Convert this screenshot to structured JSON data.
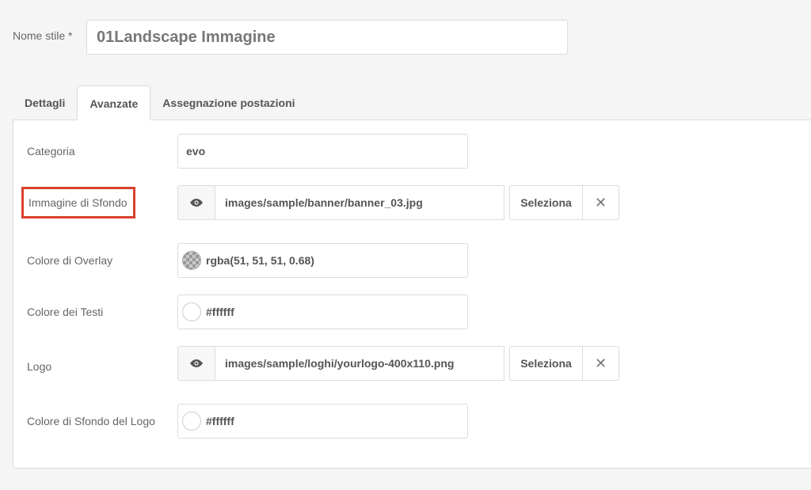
{
  "style_name": {
    "label": "Nome stile *",
    "value": "01Landscape Immagine"
  },
  "tabs": [
    {
      "label": "Dettagli",
      "active": false
    },
    {
      "label": "Avanzate",
      "active": true
    },
    {
      "label": "Assegnazione postazioni",
      "active": false
    }
  ],
  "fields": {
    "categoria": {
      "label": "Categoria",
      "value": "evo"
    },
    "immagine_sfondo": {
      "label": "Immagine di Sfondo",
      "value": "images/sample/banner/banner_03.jpg",
      "select_label": "Seleziona",
      "preview_icon": "eye-icon",
      "clear_icon": "close-icon"
    },
    "colore_overlay": {
      "label": "Colore di Overlay",
      "value": "rgba(51, 51, 51, 0.68)"
    },
    "colore_testi": {
      "label": "Colore dei Testi",
      "value": "#ffffff"
    },
    "logo": {
      "label": "Logo",
      "value": "images/sample/loghi/yourlogo-400x110.png",
      "select_label": "Seleziona",
      "preview_icon": "eye-icon",
      "clear_icon": "close-icon"
    },
    "colore_sfondo_logo": {
      "label": "Colore di Sfondo del Logo",
      "value": "#ffffff"
    }
  },
  "colors": {
    "highlight": "#d9412d",
    "border": "#dcdcdc",
    "background": "#f5f5f5"
  }
}
